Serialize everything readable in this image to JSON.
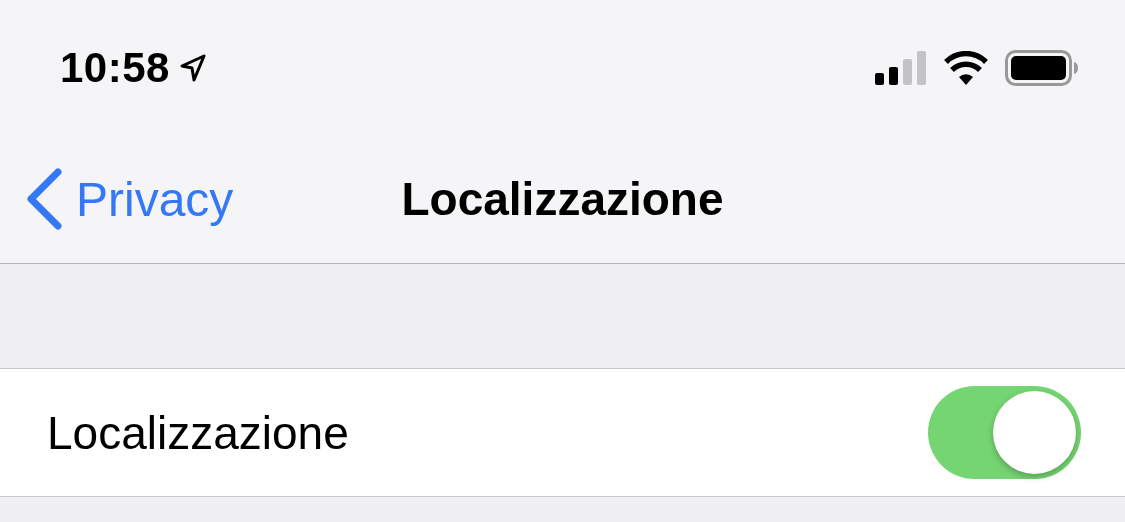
{
  "status_bar": {
    "time": "10:58",
    "location_active": true
  },
  "nav_bar": {
    "back_label": "Privacy",
    "title": "Localizzazione"
  },
  "rows": [
    {
      "label": "Localizzazione",
      "on": true
    }
  ]
}
